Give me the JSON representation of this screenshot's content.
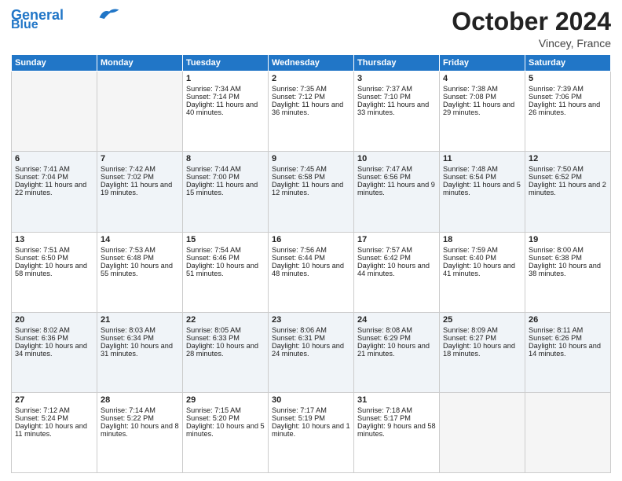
{
  "header": {
    "logo_line1": "General",
    "logo_line2": "Blue",
    "month": "October 2024",
    "location": "Vincey, France"
  },
  "days_of_week": [
    "Sunday",
    "Monday",
    "Tuesday",
    "Wednesday",
    "Thursday",
    "Friday",
    "Saturday"
  ],
  "weeks": [
    [
      {
        "day": "",
        "data": ""
      },
      {
        "day": "",
        "data": ""
      },
      {
        "day": "1",
        "data": "Sunrise: 7:34 AM\nSunset: 7:14 PM\nDaylight: 11 hours and 40 minutes."
      },
      {
        "day": "2",
        "data": "Sunrise: 7:35 AM\nSunset: 7:12 PM\nDaylight: 11 hours and 36 minutes."
      },
      {
        "day": "3",
        "data": "Sunrise: 7:37 AM\nSunset: 7:10 PM\nDaylight: 11 hours and 33 minutes."
      },
      {
        "day": "4",
        "data": "Sunrise: 7:38 AM\nSunset: 7:08 PM\nDaylight: 11 hours and 29 minutes."
      },
      {
        "day": "5",
        "data": "Sunrise: 7:39 AM\nSunset: 7:06 PM\nDaylight: 11 hours and 26 minutes."
      }
    ],
    [
      {
        "day": "6",
        "data": "Sunrise: 7:41 AM\nSunset: 7:04 PM\nDaylight: 11 hours and 22 minutes."
      },
      {
        "day": "7",
        "data": "Sunrise: 7:42 AM\nSunset: 7:02 PM\nDaylight: 11 hours and 19 minutes."
      },
      {
        "day": "8",
        "data": "Sunrise: 7:44 AM\nSunset: 7:00 PM\nDaylight: 11 hours and 15 minutes."
      },
      {
        "day": "9",
        "data": "Sunrise: 7:45 AM\nSunset: 6:58 PM\nDaylight: 11 hours and 12 minutes."
      },
      {
        "day": "10",
        "data": "Sunrise: 7:47 AM\nSunset: 6:56 PM\nDaylight: 11 hours and 9 minutes."
      },
      {
        "day": "11",
        "data": "Sunrise: 7:48 AM\nSunset: 6:54 PM\nDaylight: 11 hours and 5 minutes."
      },
      {
        "day": "12",
        "data": "Sunrise: 7:50 AM\nSunset: 6:52 PM\nDaylight: 11 hours and 2 minutes."
      }
    ],
    [
      {
        "day": "13",
        "data": "Sunrise: 7:51 AM\nSunset: 6:50 PM\nDaylight: 10 hours and 58 minutes."
      },
      {
        "day": "14",
        "data": "Sunrise: 7:53 AM\nSunset: 6:48 PM\nDaylight: 10 hours and 55 minutes."
      },
      {
        "day": "15",
        "data": "Sunrise: 7:54 AM\nSunset: 6:46 PM\nDaylight: 10 hours and 51 minutes."
      },
      {
        "day": "16",
        "data": "Sunrise: 7:56 AM\nSunset: 6:44 PM\nDaylight: 10 hours and 48 minutes."
      },
      {
        "day": "17",
        "data": "Sunrise: 7:57 AM\nSunset: 6:42 PM\nDaylight: 10 hours and 44 minutes."
      },
      {
        "day": "18",
        "data": "Sunrise: 7:59 AM\nSunset: 6:40 PM\nDaylight: 10 hours and 41 minutes."
      },
      {
        "day": "19",
        "data": "Sunrise: 8:00 AM\nSunset: 6:38 PM\nDaylight: 10 hours and 38 minutes."
      }
    ],
    [
      {
        "day": "20",
        "data": "Sunrise: 8:02 AM\nSunset: 6:36 PM\nDaylight: 10 hours and 34 minutes."
      },
      {
        "day": "21",
        "data": "Sunrise: 8:03 AM\nSunset: 6:34 PM\nDaylight: 10 hours and 31 minutes."
      },
      {
        "day": "22",
        "data": "Sunrise: 8:05 AM\nSunset: 6:33 PM\nDaylight: 10 hours and 28 minutes."
      },
      {
        "day": "23",
        "data": "Sunrise: 8:06 AM\nSunset: 6:31 PM\nDaylight: 10 hours and 24 minutes."
      },
      {
        "day": "24",
        "data": "Sunrise: 8:08 AM\nSunset: 6:29 PM\nDaylight: 10 hours and 21 minutes."
      },
      {
        "day": "25",
        "data": "Sunrise: 8:09 AM\nSunset: 6:27 PM\nDaylight: 10 hours and 18 minutes."
      },
      {
        "day": "26",
        "data": "Sunrise: 8:11 AM\nSunset: 6:26 PM\nDaylight: 10 hours and 14 minutes."
      }
    ],
    [
      {
        "day": "27",
        "data": "Sunrise: 7:12 AM\nSunset: 5:24 PM\nDaylight: 10 hours and 11 minutes."
      },
      {
        "day": "28",
        "data": "Sunrise: 7:14 AM\nSunset: 5:22 PM\nDaylight: 10 hours and 8 minutes."
      },
      {
        "day": "29",
        "data": "Sunrise: 7:15 AM\nSunset: 5:20 PM\nDaylight: 10 hours and 5 minutes."
      },
      {
        "day": "30",
        "data": "Sunrise: 7:17 AM\nSunset: 5:19 PM\nDaylight: 10 hours and 1 minute."
      },
      {
        "day": "31",
        "data": "Sunrise: 7:18 AM\nSunset: 5:17 PM\nDaylight: 9 hours and 58 minutes."
      },
      {
        "day": "",
        "data": ""
      },
      {
        "day": "",
        "data": ""
      }
    ]
  ]
}
